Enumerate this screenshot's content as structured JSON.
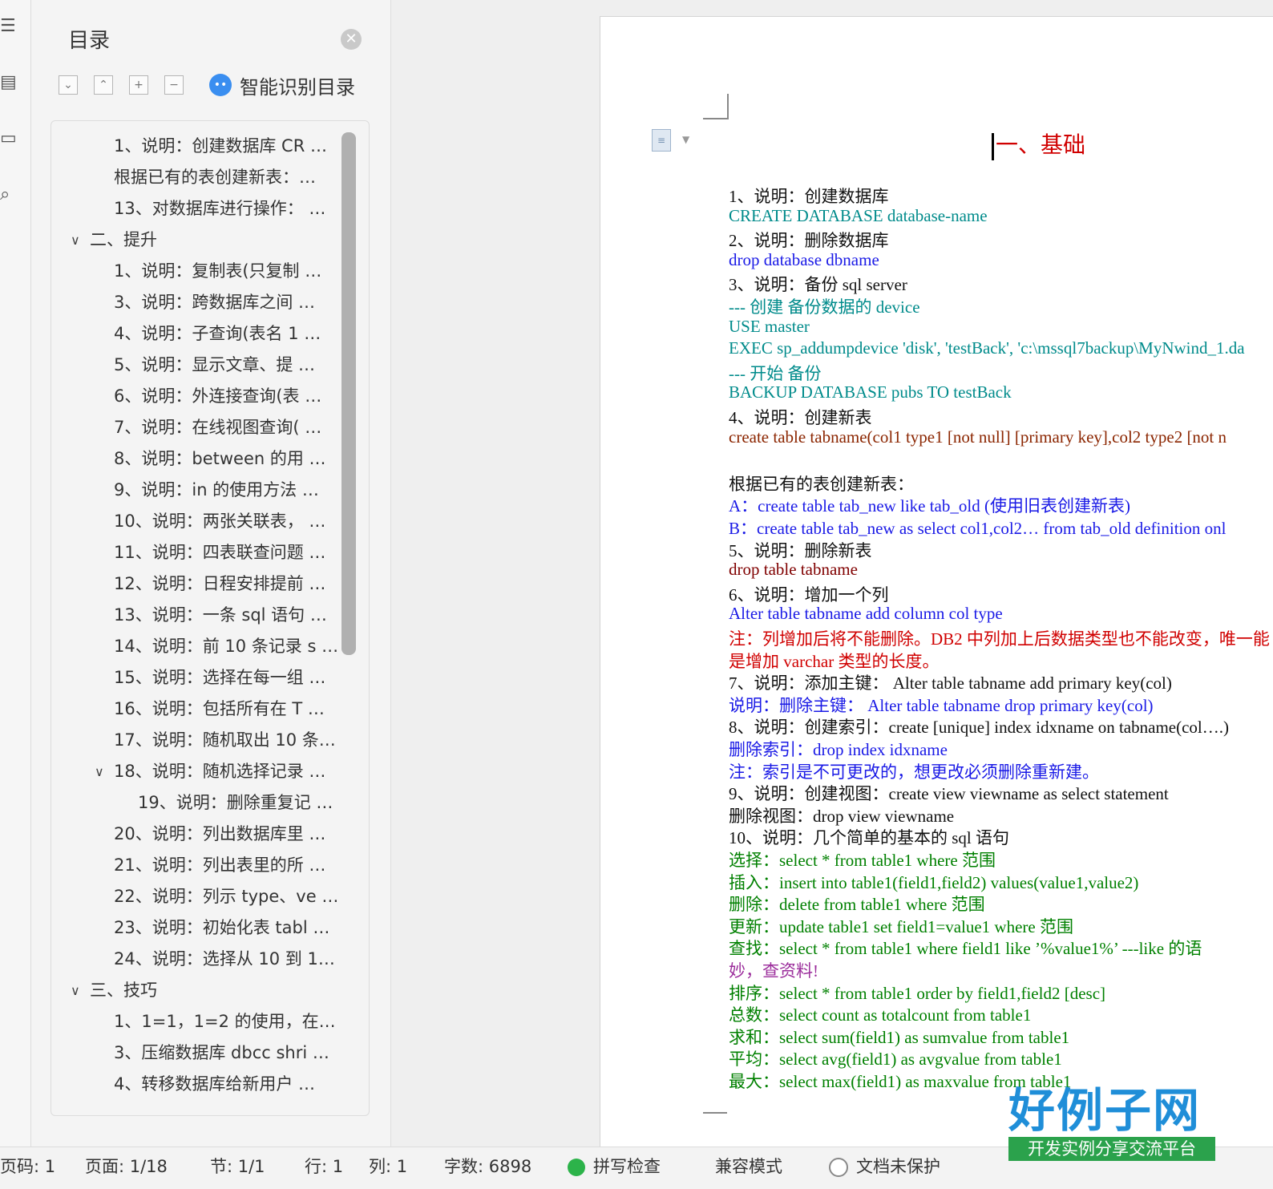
{
  "toc": {
    "title": "目录",
    "smart_label": "智能识别目录",
    "items": [
      {
        "label": "1、说明：创建数据库 CR …",
        "indent": 2
      },
      {
        "label": "根据已有的表创建新表：…",
        "indent": 2
      },
      {
        "label": "13、对数据库进行操作：   …",
        "indent": 2
      },
      {
        "label": "二、提升",
        "indent": 1,
        "expanded": true
      },
      {
        "label": "1、说明：复制表(只复制 …",
        "indent": 2
      },
      {
        "label": "3、说明：跨数据库之间 …",
        "indent": 2
      },
      {
        "label": "4、说明：子查询(表名 1 …",
        "indent": 2
      },
      {
        "label": "5、说明：显示文章、提 …",
        "indent": 2
      },
      {
        "label": "6、说明：外连接查询(表 …",
        "indent": 2
      },
      {
        "label": "7、说明：在线视图查询( …",
        "indent": 2
      },
      {
        "label": "8、说明：between 的用 …",
        "indent": 2
      },
      {
        "label": "9、说明：in 的使用方法 …",
        "indent": 2
      },
      {
        "label": "10、说明：两张关联表，  …",
        "indent": 2
      },
      {
        "label": "11、说明：四表联查问题 …",
        "indent": 2
      },
      {
        "label": "12、说明：日程安排提前 …",
        "indent": 2
      },
      {
        "label": "13、说明：一条 sql 语句 …",
        "indent": 2
      },
      {
        "label": "14、说明：前 10 条记录 s …",
        "indent": 2
      },
      {
        "label": "15、说明：选择在每一组  …",
        "indent": 2
      },
      {
        "label": "16、说明：包括所有在  T …",
        "indent": 2
      },
      {
        "label": "17、说明：随机取出 10 条 …",
        "indent": 2
      },
      {
        "label": "18、说明：随机选择记录  …",
        "indent": 2,
        "expanded": true
      },
      {
        "label": "19、说明：删除重复记 …",
        "indent": 3
      },
      {
        "label": "20、说明：列出数据库里 …",
        "indent": 2
      },
      {
        "label": "21、说明：列出表里的所 …",
        "indent": 2
      },
      {
        "label": "22、说明：列示 type、ve …",
        "indent": 2
      },
      {
        "label": "23、说明：初始化表 tabl …",
        "indent": 2
      },
      {
        "label": "24、说明：选择从 10 到 1 …",
        "indent": 2
      },
      {
        "label": "三、技巧",
        "indent": 1,
        "expanded": true
      },
      {
        "label": "1、1=1，1=2 的使用，在 …",
        "indent": 2
      },
      {
        "label": "3、压缩数据库 dbcc  shri …",
        "indent": 2
      },
      {
        "label": "4、转移数据库给新用户 …",
        "indent": 2
      }
    ]
  },
  "document": {
    "heading": "一、基础",
    "lines": [
      {
        "text": "1、说明：创建数据库",
        "color": "black"
      },
      {
        "text": "CREATE DATABASE database-name",
        "color": "teal"
      },
      {
        "text": "2、说明：删除数据库",
        "color": "black"
      },
      {
        "text": "drop database dbname",
        "color": "blue"
      },
      {
        "text": "3、说明：备份 sql server",
        "color": "black"
      },
      {
        "text": "--- 创建 备份数据的 device",
        "color": "teal"
      },
      {
        "text": "USE master",
        "color": "teal"
      },
      {
        "text": "EXEC sp_addumpdevice 'disk', 'testBack', 'c:\\mssql7backup\\MyNwind_1.da",
        "color": "teal"
      },
      {
        "text": "--- 开始 备份",
        "color": "teal"
      },
      {
        "text": "BACKUP DATABASE pubs TO testBack",
        "color": "teal"
      },
      {
        "text": "4、说明：创建新表",
        "color": "black"
      },
      {
        "text": "create table tabname(col1 type1 [not null] [primary key],col2 type2 [not n",
        "color": "brown"
      },
      {
        "text": "",
        "color": "black"
      },
      {
        "text": "根据已有的表创建新表：",
        "color": "black"
      },
      {
        "text": "A：create table tab_new like tab_old (使用旧表创建新表)",
        "color": "blue"
      },
      {
        "text": "B：create table tab_new as select col1,col2… from tab_old definition onl",
        "color": "blue"
      },
      {
        "text": "5、说明：删除新表",
        "color": "black"
      },
      {
        "text": "drop table tabname",
        "color": "darkred"
      },
      {
        "text": "6、说明：增加一个列",
        "color": "black"
      },
      {
        "text": "Alter table tabname add column col type",
        "color": "blue"
      },
      {
        "text": "注：列增加后将不能删除。DB2 中列加上后数据类型也不能改变，唯一能",
        "color": "red"
      },
      {
        "text": "是增加 varchar 类型的长度。",
        "color": "red"
      },
      {
        "text": "7、说明：添加主键：  Alter table tabname add primary key(col)",
        "color": "black"
      },
      {
        "text": "说明：删除主键：  Alter table tabname drop primary key(col)",
        "color": "blue"
      },
      {
        "text": "8、说明：创建索引：create [unique] index idxname on tabname(col….)",
        "color": "black"
      },
      {
        "text": "删除索引：drop index idxname",
        "color": "blue"
      },
      {
        "text": "注：索引是不可更改的，想更改必须删除重新建。",
        "color": "blue"
      },
      {
        "text": "9、说明：创建视图：create view viewname as select statement",
        "color": "black"
      },
      {
        "text": "删除视图：drop view viewname",
        "color": "black"
      },
      {
        "text": "10、说明：几个简单的基本的 sql 语句",
        "color": "black"
      },
      {
        "text": "选择：select * from table1 where 范围",
        "color": "green"
      },
      {
        "text": "插入：insert into table1(field1,field2) values(value1,value2)",
        "color": "green"
      },
      {
        "text": "删除：delete from table1 where 范围",
        "color": "green"
      },
      {
        "text": "更新：update table1 set field1=value1 where 范围",
        "color": "green"
      },
      {
        "text": "查找：select * from table1 where field1 like ’%value1%’ ---like 的语",
        "color": "green"
      },
      {
        "text": "妙，查资料!",
        "color": "purple"
      },
      {
        "text": "排序：select * from table1 order by field1,field2 [desc]",
        "color": "green"
      },
      {
        "text": "总数：select count as totalcount from table1",
        "color": "green"
      },
      {
        "text": "求和：select sum(field1) as sumvalue from table1",
        "color": "green"
      },
      {
        "text": "平均：select avg(field1) as avgvalue from table1",
        "color": "green"
      },
      {
        "text": "最大：select max(field1) as maxvalue from table1",
        "color": "green"
      }
    ]
  },
  "status": {
    "page_code": "页码: 1",
    "page": "页面: 1/18",
    "section": "节: 1/1",
    "row": "行: 1",
    "col": "列: 1",
    "word_count": "字数: 6898",
    "spell_check": "拼写检查",
    "compat_mode": "兼容模式",
    "doc_protect": "文档未保护"
  },
  "logo": {
    "main": "好例子网",
    "sub": "开发实例分享交流平台"
  },
  "colors": {
    "black": "#111111",
    "teal": "#008b8b",
    "blue": "#1a1ae6",
    "brown": "#8b2500",
    "darkred": "#800000",
    "green": "#008000",
    "red": "#d00000",
    "purple": "#9b2d9b"
  }
}
